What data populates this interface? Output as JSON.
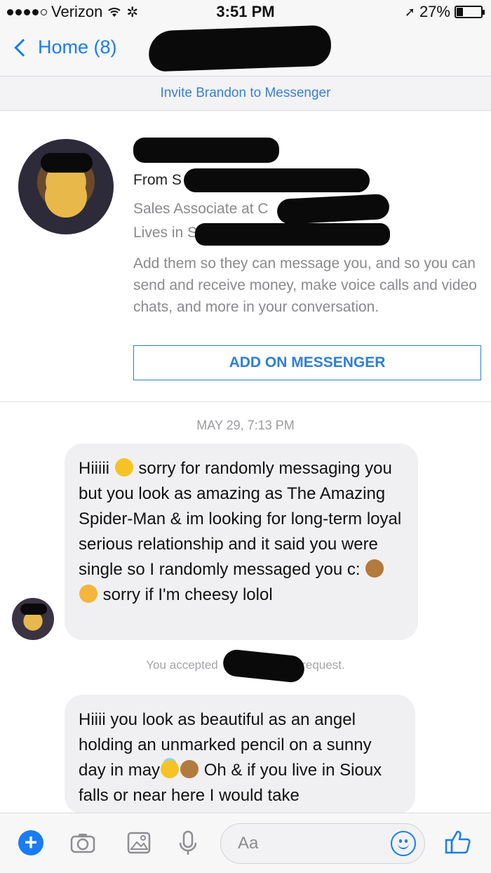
{
  "status_bar": {
    "carrier": "Verizon",
    "time": "3:51 PM",
    "battery": "27%",
    "battery_level": 0.27
  },
  "nav": {
    "back_label": "Home (8)"
  },
  "invite": {
    "text": "Invite Brandon to Messenger"
  },
  "profile": {
    "from_prefix": "From S",
    "sales_prefix": "Sales Associate at C",
    "lives_prefix": "Lives in S",
    "description": "Add them so they can message you, and so you can send and receive money, make voice calls and video chats, and more in your conversation.",
    "add_button": "ADD ON MESSENGER"
  },
  "thread": {
    "timestamp": "MAY 29, 7:13 PM",
    "message1": {
      "part1": "Hiiiii",
      "part2": " sorry for randomly messaging you but you look as amazing as The Amazing Spider-Man & im looking for long-term loyal serious relationship and it said you were single so I randomly messaged you c: ",
      "part3": " sorry if I'm cheesy lolol"
    },
    "accepted_prefix": "You accepted",
    "accepted_suffix": "request.",
    "message2": {
      "part1": "Hiiii you look as beautiful as an angel holding an unmarked pencil on a sunny day in may",
      "part2": " Oh & if you live in Sioux falls or near here I would take"
    }
  },
  "composer": {
    "placeholder": "Aa",
    "icons": [
      "plus-icon",
      "camera-icon",
      "gallery-icon",
      "microphone-icon",
      "emoji-icon",
      "thumbs-up-icon"
    ],
    "accent": "#1a7cf2"
  }
}
